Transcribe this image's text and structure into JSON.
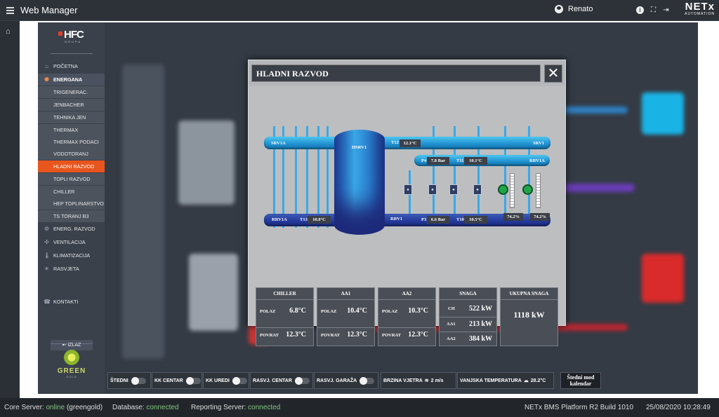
{
  "app": {
    "title": "Web Manager",
    "user": "Renato",
    "brand": "NETx",
    "brand_sub": "AUTOMATION"
  },
  "sidebar": {
    "logo": "HFC",
    "logo_sub": "GRUPA",
    "items": [
      {
        "label": "POČETNA",
        "icon": "home-icon"
      },
      {
        "label": "ENERGANA",
        "icon": "sun-icon"
      },
      {
        "label": "TRIGENERAC."
      },
      {
        "label": "JENBACHER"
      },
      {
        "label": "TEHNIKA JEN"
      },
      {
        "label": "THERMAX"
      },
      {
        "label": "THERMAX PODACI"
      },
      {
        "label": "VODOTORANJ"
      },
      {
        "label": "HLADNI RAZVOD"
      },
      {
        "label": "TOPLI RAZVOD"
      },
      {
        "label": "CHILLER"
      },
      {
        "label": "HEP TOPLINARSTVO"
      },
      {
        "label": "TS TORANJ B3"
      },
      {
        "label": "ENERG. RAZVOD",
        "icon": "gear-icon"
      },
      {
        "label": "VENTILACIJA",
        "icon": "fan-icon"
      },
      {
        "label": "KLIMATIZACIJA",
        "icon": "thermometer-icon"
      },
      {
        "label": "RASVJETA",
        "icon": "light-icon"
      },
      {
        "label": "KONTAKTI",
        "icon": "contacts-icon"
      }
    ],
    "logout": "IZLAZ",
    "green": "GREEN",
    "green_sub": "GOLD"
  },
  "modal": {
    "title": "HLADNI RAZVOD",
    "labels": {
      "srv1a": "SRV1A",
      "srv1": "SRV1",
      "hsrv1": "HSRV1",
      "rrv1a_top": "RRV1A",
      "rrv1a_bot": "RRV1A",
      "rrv1": "RRV1",
      "t12": "T12",
      "t11": "T11",
      "t13": "T13",
      "t10": "T10",
      "p4": "P4",
      "p3": "P3"
    },
    "values": {
      "t12": "12.1°C",
      "p4": "7.8 Bar",
      "t11": "10.1°C",
      "t13": "10.8°C",
      "p3": "6.6 Bar",
      "t10": "10.5°C",
      "g1": "74.2%",
      "g2": "74.2%"
    },
    "cards": {
      "chiller": {
        "title": "CHILLER",
        "polaz_label": "POLAZ",
        "polaz": "6.8°C",
        "povrat_label": "POVRAT",
        "povrat": "12.3°C"
      },
      "aa1": {
        "title": "AA1",
        "polaz_label": "POLAZ",
        "polaz": "10.4°C",
        "povrat_label": "POVRAT",
        "povrat": "12.3°C"
      },
      "aa2": {
        "title": "AA2",
        "polaz_label": "POLAZ",
        "polaz": "10.3°C",
        "povrat_label": "POVRAT",
        "povrat": "12.3°C"
      },
      "snaga": {
        "title": "SNAGA",
        "r1k": "CH",
        "r1v": "522 kW",
        "r2k": "AA1",
        "r2v": "213 kW",
        "r3k": "AA2",
        "r3v": "384 kW"
      },
      "ukupna": {
        "title": "UKUPNA SNAGA",
        "value": "1118 kW"
      }
    }
  },
  "bottom": {
    "toggles": [
      "ŠTEDNI",
      "KK CENTAR",
      "KK UREDI",
      "RASVJ. CENTAR",
      "RASVJ. GARAŽA"
    ],
    "wind_label": "BRZINA VJETRA",
    "wind": "2 m/s",
    "temp_label": "VANJSKA TEMPERATURA",
    "temp": "28.2°C",
    "calendar": "Štedni mod kalendar"
  },
  "status": {
    "core_label": "Core Server:",
    "core_state": "online",
    "core_host": "(greengold)",
    "db_label": "Database:",
    "db_state": "connected",
    "rep_label": "Reporting Server:",
    "rep_state": "connected",
    "build": "NETx BMS Platform R2 Build 1010",
    "datetime": "25/08/2020 10:28:49"
  }
}
